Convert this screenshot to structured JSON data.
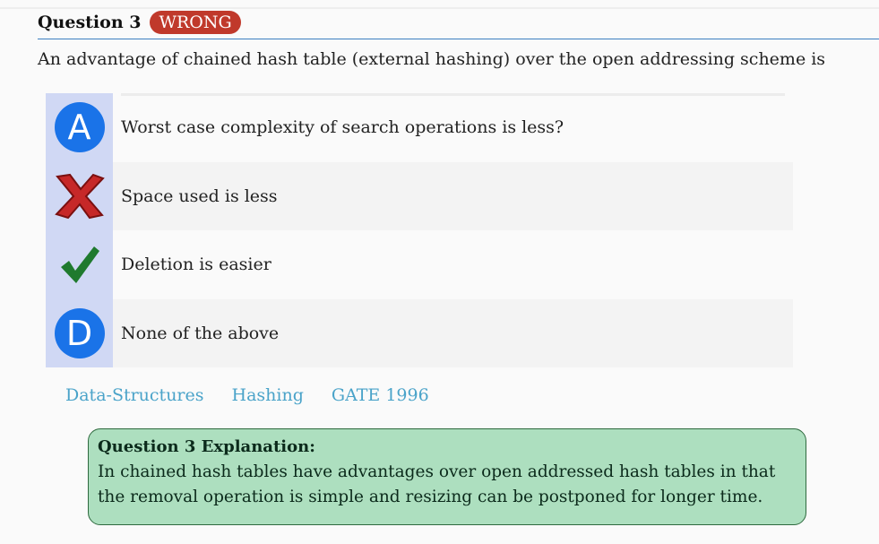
{
  "header": {
    "question_label": "Question 3",
    "status_badge": "WRONG",
    "status_color": "#c0392b"
  },
  "question_text": "An advantage of chained hash table (external hashing) over the open addressing scheme is",
  "options": [
    {
      "marker": "A",
      "marker_type": "letter-circle",
      "text": "Worst case complexity of search operations is less?"
    },
    {
      "marker": "",
      "marker_type": "x-icon",
      "text": "Space used is less"
    },
    {
      "marker": "",
      "marker_type": "check-icon",
      "text": "Deletion is easier"
    },
    {
      "marker": "D",
      "marker_type": "letter-circle",
      "text": "None of the above"
    }
  ],
  "tags": [
    "Data-Structures",
    "Hashing",
    "GATE 1996"
  ],
  "explanation": {
    "title": "Question 3 Explanation:",
    "body": "In chained hash tables have advantages over open addressed hash tables in that the removal operation is simple and resizing can be postponed for longer time."
  }
}
